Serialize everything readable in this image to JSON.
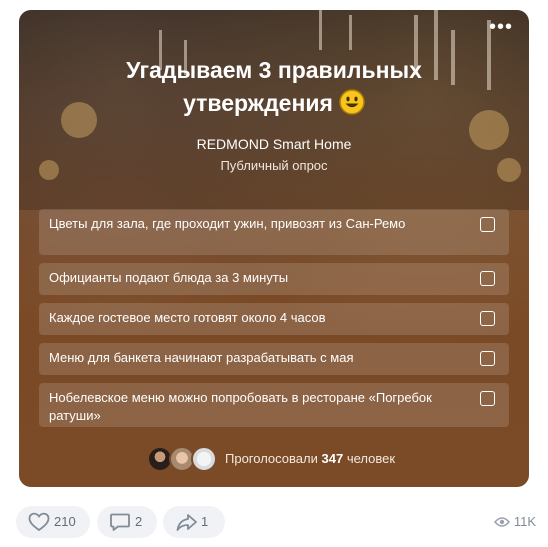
{
  "poll": {
    "title": "Угадываем 3 правильных утверждения",
    "title_emoji": "grinning-face-emoji",
    "author": "REDMOND Smart Home",
    "type": "Публичный опрос",
    "options": [
      {
        "text": "Цветы для зала, где проходит ужин, привозят из Сан-Ремо",
        "checked": false
      },
      {
        "text": "Официанты подают блюда за 3 минуты",
        "checked": false
      },
      {
        "text": "Каждое гостевое место готовят около 4 часов",
        "checked": false
      },
      {
        "text": "Меню для банкета начинают разрабатывать с мая",
        "checked": false
      },
      {
        "text": "Нобелевское меню можно попробовать в ресторане «Погребок ратуши»",
        "checked": false
      }
    ],
    "voters_prefix": "Проголосовали",
    "voters_count": "347",
    "voters_suffix": "человек"
  },
  "actions": {
    "likes": "210",
    "comments": "2",
    "shares": "1",
    "views": "11K"
  },
  "colors": {
    "card_bg": "#7b4b27",
    "action_bg": "#f0f2f5",
    "action_text": "#626d7a"
  },
  "icons": [
    "more-icon",
    "heart-icon",
    "comment-icon",
    "share-icon",
    "eye-icon",
    "checkbox-icon"
  ]
}
